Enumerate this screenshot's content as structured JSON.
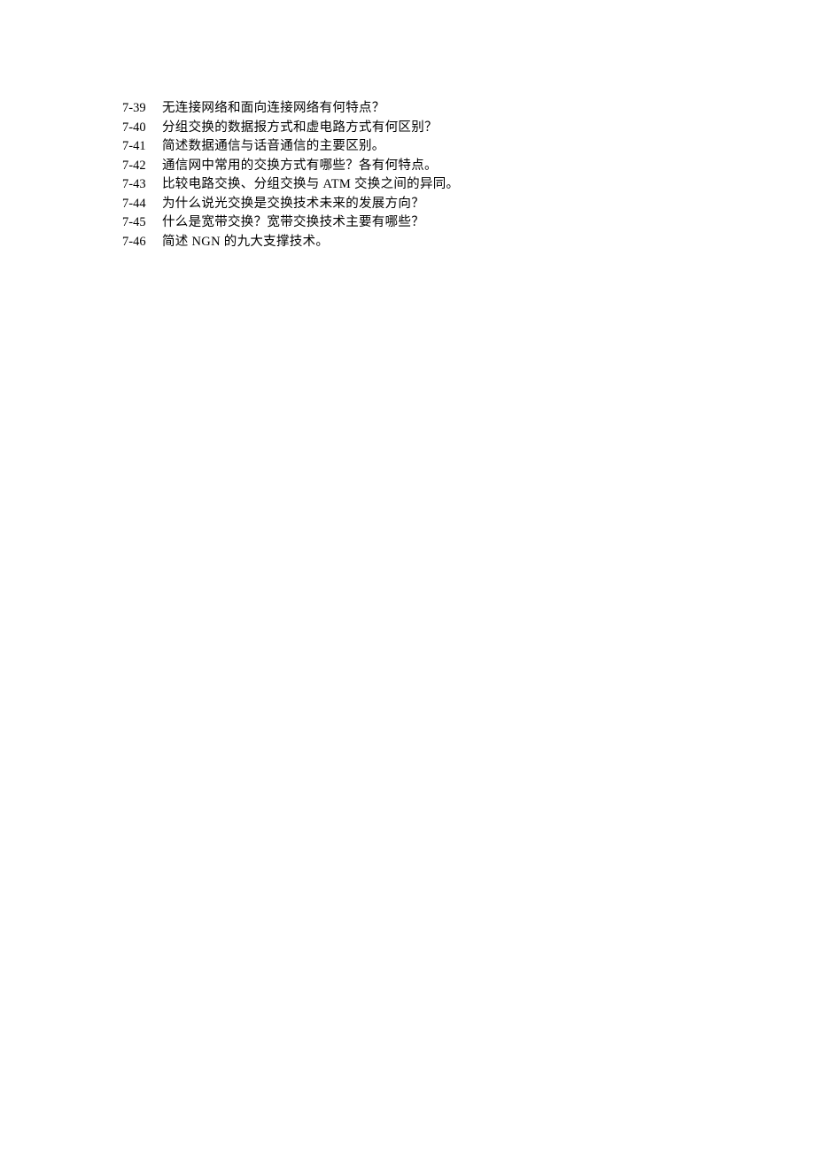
{
  "items": [
    {
      "num": "7-39",
      "txt": "无连接网络和面向连接网络有何特点？"
    },
    {
      "num": "7-40",
      "txt": "分组交换的数据报方式和虚电路方式有何区别？"
    },
    {
      "num": "7-41",
      "txt": "简述数据通信与话音通信的主要区别。"
    },
    {
      "num": "7-42",
      "txt": "通信网中常用的交换方式有哪些？各有何特点。"
    },
    {
      "num": "7-43",
      "txt": "比较电路交换、分组交换与 ATM 交换之间的异同。"
    },
    {
      "num": "7-44",
      "txt": "为什么说光交换是交换技术未来的发展方向？"
    },
    {
      "num": "7-45",
      "txt": "什么是宽带交换？宽带交换技术主要有哪些？"
    },
    {
      "num": "7-46",
      "txt": "简述 NGN 的九大支撑技术。"
    }
  ]
}
